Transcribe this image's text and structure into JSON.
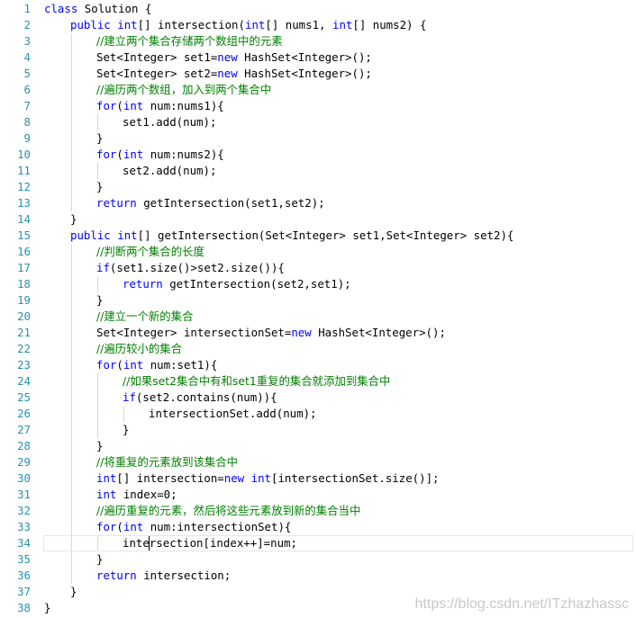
{
  "editor": {
    "lines": [
      {
        "n": "1",
        "indent": 0,
        "tokens": [
          [
            "kw",
            "class"
          ],
          [
            "t",
            " Solution {"
          ]
        ]
      },
      {
        "n": "2",
        "indent": 1,
        "tokens": [
          [
            "kw",
            "public"
          ],
          [
            "t",
            " "
          ],
          [
            "kw",
            "int"
          ],
          [
            "t",
            "[] intersection("
          ],
          [
            "kw",
            "int"
          ],
          [
            "t",
            "[] nums1, "
          ],
          [
            "kw",
            "int"
          ],
          [
            "t",
            "[] nums2) {"
          ]
        ]
      },
      {
        "n": "3",
        "indent": 2,
        "tokens": [
          [
            "cm",
            "//建立两个集合存储两个数组中的元素"
          ]
        ]
      },
      {
        "n": "4",
        "indent": 2,
        "tokens": [
          [
            "t",
            "Set<Integer> set1="
          ],
          [
            "kw",
            "new"
          ],
          [
            "t",
            " HashSet<Integer>();"
          ]
        ]
      },
      {
        "n": "5",
        "indent": 2,
        "tokens": [
          [
            "t",
            "Set<Integer> set2="
          ],
          [
            "kw",
            "new"
          ],
          [
            "t",
            " HashSet<Integer>();"
          ]
        ]
      },
      {
        "n": "6",
        "indent": 2,
        "tokens": [
          [
            "cm",
            "//遍历两个数组，加入到两个集合中"
          ]
        ]
      },
      {
        "n": "7",
        "indent": 2,
        "tokens": [
          [
            "kw",
            "for"
          ],
          [
            "t",
            "("
          ],
          [
            "kw",
            "int"
          ],
          [
            "t",
            " num:nums1){"
          ]
        ]
      },
      {
        "n": "8",
        "indent": 3,
        "tokens": [
          [
            "t",
            "set1.add(num);"
          ]
        ]
      },
      {
        "n": "9",
        "indent": 2,
        "tokens": [
          [
            "t",
            "}"
          ]
        ]
      },
      {
        "n": "10",
        "indent": 2,
        "tokens": [
          [
            "kw",
            "for"
          ],
          [
            "t",
            "("
          ],
          [
            "kw",
            "int"
          ],
          [
            "t",
            " num:nums2){"
          ]
        ]
      },
      {
        "n": "11",
        "indent": 3,
        "tokens": [
          [
            "t",
            "set2.add(num);"
          ]
        ]
      },
      {
        "n": "12",
        "indent": 2,
        "tokens": [
          [
            "t",
            "}"
          ]
        ]
      },
      {
        "n": "13",
        "indent": 2,
        "tokens": [
          [
            "kw",
            "return"
          ],
          [
            "t",
            " getIntersection(set1,set2);"
          ]
        ]
      },
      {
        "n": "14",
        "indent": 1,
        "tokens": [
          [
            "t",
            "}"
          ]
        ]
      },
      {
        "n": "15",
        "indent": 1,
        "tokens": [
          [
            "kw",
            "public"
          ],
          [
            "t",
            " "
          ],
          [
            "kw",
            "int"
          ],
          [
            "t",
            "[] getIntersection(Set<Integer> set1,Set<Integer> set2){"
          ]
        ]
      },
      {
        "n": "16",
        "indent": 2,
        "tokens": [
          [
            "cm",
            "//判断两个集合的长度"
          ]
        ]
      },
      {
        "n": "17",
        "indent": 2,
        "tokens": [
          [
            "kw",
            "if"
          ],
          [
            "t",
            "(set1.size()>set2.size()){"
          ]
        ]
      },
      {
        "n": "18",
        "indent": 3,
        "tokens": [
          [
            "kw",
            "return"
          ],
          [
            "t",
            " getIntersection(set2,set1);"
          ]
        ]
      },
      {
        "n": "19",
        "indent": 2,
        "tokens": [
          [
            "t",
            "}"
          ]
        ]
      },
      {
        "n": "20",
        "indent": 2,
        "tokens": [
          [
            "cm",
            "//建立一个新的集合"
          ]
        ]
      },
      {
        "n": "21",
        "indent": 2,
        "tokens": [
          [
            "t",
            "Set<Integer> intersectionSet="
          ],
          [
            "kw",
            "new"
          ],
          [
            "t",
            " HashSet<Integer>();"
          ]
        ]
      },
      {
        "n": "22",
        "indent": 2,
        "tokens": [
          [
            "cm",
            "//遍历较小的集合"
          ]
        ]
      },
      {
        "n": "23",
        "indent": 2,
        "tokens": [
          [
            "kw",
            "for"
          ],
          [
            "t",
            "("
          ],
          [
            "kw",
            "int"
          ],
          [
            "t",
            " num:set1){"
          ]
        ]
      },
      {
        "n": "24",
        "indent": 3,
        "tokens": [
          [
            "cm",
            "//如果set2集合中有和set1重复的集合就添加到集合中"
          ]
        ]
      },
      {
        "n": "25",
        "indent": 3,
        "tokens": [
          [
            "kw",
            "if"
          ],
          [
            "t",
            "(set2.contains(num)){"
          ]
        ]
      },
      {
        "n": "26",
        "indent": 4,
        "tokens": [
          [
            "t",
            "intersectionSet.add(num);"
          ]
        ]
      },
      {
        "n": "27",
        "indent": 3,
        "tokens": [
          [
            "t",
            "}"
          ]
        ]
      },
      {
        "n": "28",
        "indent": 2,
        "tokens": [
          [
            "t",
            "}"
          ]
        ]
      },
      {
        "n": "29",
        "indent": 2,
        "tokens": [
          [
            "cm",
            "//将重复的元素放到该集合中"
          ]
        ]
      },
      {
        "n": "30",
        "indent": 2,
        "tokens": [
          [
            "kw",
            "int"
          ],
          [
            "t",
            "[] intersection="
          ],
          [
            "kw",
            "new"
          ],
          [
            "t",
            " "
          ],
          [
            "kw",
            "int"
          ],
          [
            "t",
            "[intersectionSet.size()];"
          ]
        ]
      },
      {
        "n": "31",
        "indent": 2,
        "tokens": [
          [
            "kw",
            "int"
          ],
          [
            "t",
            " index=0;"
          ]
        ]
      },
      {
        "n": "32",
        "indent": 2,
        "tokens": [
          [
            "cm",
            "//遍历重复的元素，然后将这些元素放到新的集合当中"
          ]
        ]
      },
      {
        "n": "33",
        "indent": 2,
        "tokens": [
          [
            "kw",
            "for"
          ],
          [
            "t",
            "("
          ],
          [
            "kw",
            "int"
          ],
          [
            "t",
            " num:intersectionSet){"
          ]
        ]
      },
      {
        "n": "34",
        "indent": 3,
        "tokens": [
          [
            "t",
            "intersection[index++]=num;"
          ]
        ],
        "current": true
      },
      {
        "n": "35",
        "indent": 2,
        "tokens": [
          [
            "t",
            "}"
          ]
        ]
      },
      {
        "n": "36",
        "indent": 2,
        "tokens": [
          [
            "kw",
            "return"
          ],
          [
            "t",
            " intersection;"
          ]
        ]
      },
      {
        "n": "37",
        "indent": 1,
        "tokens": [
          [
            "t",
            "}"
          ]
        ]
      },
      {
        "n": "38",
        "indent": 0,
        "tokens": [
          [
            "t",
            "}"
          ]
        ]
      }
    ]
  },
  "watermark": "https://blog.csdn.net/ITzhazhassc",
  "colors": {
    "keyword": "#0000ff",
    "comment": "#008000",
    "line_number": "#2b91af",
    "text": "#000000",
    "watermark": "#c8c8c8"
  }
}
